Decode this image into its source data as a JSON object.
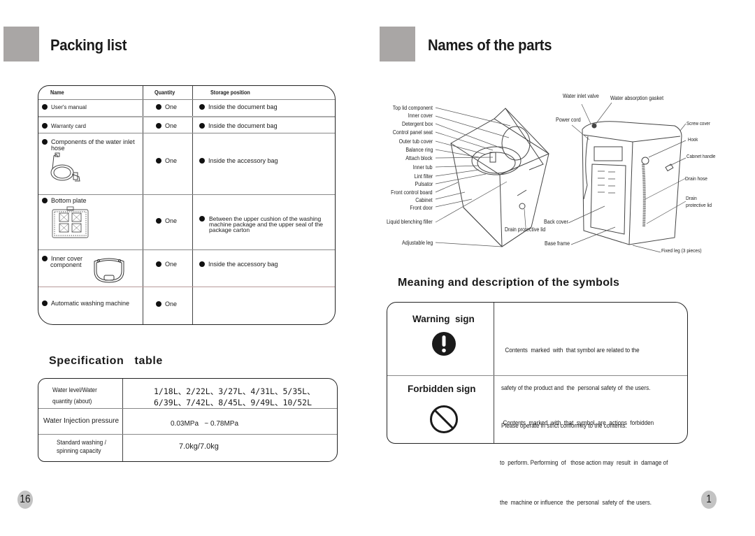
{
  "left_page": {
    "title": "Packing list",
    "page_number": "16",
    "packing_table": {
      "headers": [
        "Name",
        "Quantity",
        "Storage position"
      ],
      "rows": [
        {
          "name": "User's manual",
          "quantity": "One",
          "storage": "Inside the document bag"
        },
        {
          "name": "Warranty card",
          "quantity": "One",
          "storage": "Inside the document bag"
        },
        {
          "name": "Components of the water inlet hose",
          "quantity": "One",
          "storage": "Inside the accessory bag"
        },
        {
          "name": "Bottom plate",
          "quantity": "One",
          "storage": "Between  the upper cushion of  the washing machine package and the upper seal of the package carton"
        },
        {
          "name": "Inner cover component",
          "quantity": "One",
          "storage": "Inside the accessory bag"
        },
        {
          "name": "Automatic washing machine",
          "quantity": "One",
          "storage": ""
        }
      ]
    },
    "spec_title": "Specification   table",
    "spec_table": {
      "rows": [
        {
          "label_line1": "Water level/Water",
          "label_line2": "quantity (about)",
          "value_line1": "1/18L、2/22L、3/27L、4/31L、5/35L、",
          "value_line2": "6/39L、7/42L、8/45L、9/49L、10/52L"
        },
        {
          "label_line1": "Water Injection pressure",
          "label_line2": "",
          "value_line1": "0.03MPa   ~ 0.78MPa",
          "value_line2": ""
        },
        {
          "label_line1": "Standard washing /",
          "label_line2": "spinning capacity",
          "value_line1": "7.0kg/7.0kg",
          "value_line2": ""
        }
      ]
    }
  },
  "right_page": {
    "title": "Names of the parts",
    "page_number": "1",
    "parts_left": [
      "Top lid component",
      "Inner cover",
      "Detergent box",
      "Control panel seat",
      "Outer tub cover",
      "Balance ring",
      "Attach block",
      "Inner tub",
      "Lint filter",
      "Pulsator",
      "Front control board",
      "Cabinet",
      "Front door",
      "Liquid blenching filler",
      "Adjustable leg"
    ],
    "parts_middle": [
      "Drain protective lid",
      "Back cover",
      "Base frame",
      "Power cord",
      "Water inlet valve",
      "Water absorption gasket"
    ],
    "parts_right": [
      "Screw cover",
      "Hook",
      "Cabinet handle",
      "Drain hose",
      "Drain protective lid",
      "Fixed leg (3 pieces)"
    ],
    "symbols_title": "Meaning and description of the symbols",
    "symbols": [
      {
        "name": "Warning  sign",
        "icon": "exclamation-circle-icon",
        "lines": [
          "Contents  marked  with  that symbol are related to the",
          "safety of the product and  the  personal safety of  the users.",
          "Please operate in strict conformity to the contents."
        ]
      },
      {
        "name": "Forbidden sign",
        "icon": "prohibited-icon",
        "lines": [
          "Contents  marked  with  that  symbol  are  actions  forbidden",
          "to  perform. Performing  of   those action may  result  in  damage of",
          "the  machine or influence  the  personal  safety of  the users."
        ]
      }
    ]
  }
}
